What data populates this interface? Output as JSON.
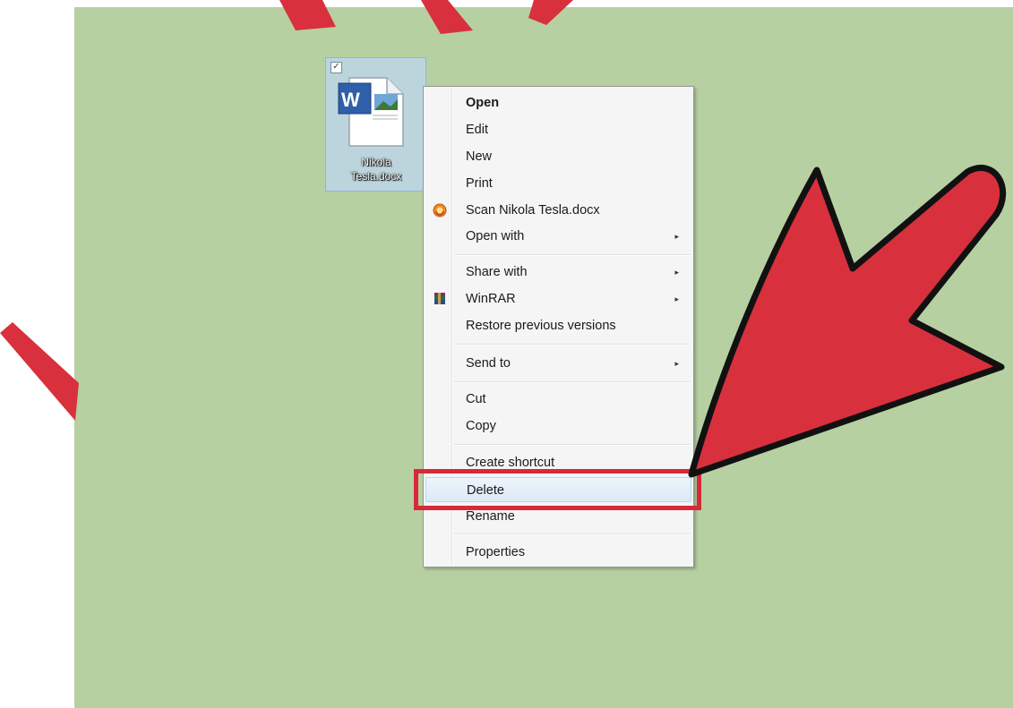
{
  "desktop": {
    "background_color": "#b6d0a2"
  },
  "file": {
    "name": "Nikola Tesla.docx",
    "label_line1": "Nikola",
    "label_line2": "Tesla.docx",
    "icon": "word-document-icon",
    "selected": true
  },
  "context_menu": {
    "items": [
      {
        "label": "Open",
        "bold": true
      },
      {
        "label": "Edit"
      },
      {
        "label": "New"
      },
      {
        "label": "Print"
      },
      {
        "label": "Scan Nikola Tesla.docx",
        "icon": "antivirus-scan-icon"
      },
      {
        "label": "Open with",
        "submenu": true
      },
      {
        "label": "Share with",
        "submenu": true
      },
      {
        "label": "WinRAR",
        "icon": "winrar-icon",
        "submenu": true
      },
      {
        "label": "Restore previous versions"
      },
      {
        "label": "Send to",
        "submenu": true
      },
      {
        "label": "Cut"
      },
      {
        "label": "Copy"
      },
      {
        "label": "Create shortcut"
      },
      {
        "label": "Delete",
        "highlighted": true
      },
      {
        "label": "Rename"
      },
      {
        "label": "Properties"
      }
    ],
    "submenu_arrow": "▸"
  },
  "annotation": {
    "highlight_color": "#d92838",
    "arrow_color": "#d9303d",
    "target": "Delete"
  }
}
